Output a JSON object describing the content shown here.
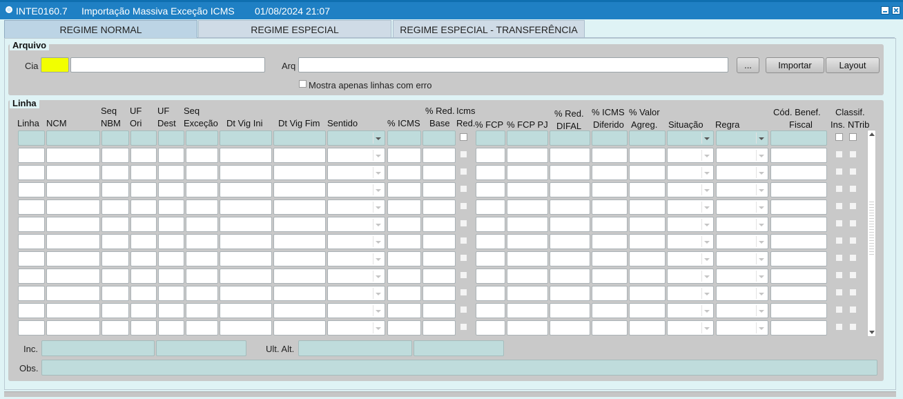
{
  "window": {
    "code": "INTE0160.7",
    "title": "Importação Massiva Exceção ICMS",
    "datetime": "01/08/2024 21:07"
  },
  "tabs": [
    {
      "label": "REGIME NORMAL",
      "active": true
    },
    {
      "label": "REGIME ESPECIAL",
      "active": false
    },
    {
      "label": "REGIME ESPECIAL - TRANSFERÊNCIA",
      "active": false
    }
  ],
  "arquivo": {
    "legend": "Arquivo",
    "cia_label": "Cia",
    "cia_value": "",
    "cia_name_value": "",
    "arq_label": "Arq",
    "arq_value": "",
    "browse_label": "...",
    "import_label": "Importar",
    "layout_label": "Layout",
    "only_errors_label": "Mostra apenas linhas com erro"
  },
  "linha": {
    "legend": "Linha",
    "headers": {
      "linha": "Linha",
      "ncm": "NCM",
      "seq_nbm_1": "Seq",
      "seq_nbm_2": "NBM",
      "uf_ori_1": "UF",
      "uf_ori_2": "Ori",
      "uf_dest_1": "UF",
      "uf_dest_2": "Dest",
      "seq_exc_1": "Seq",
      "seq_exc_2": "Exceção",
      "dt_vig_ini": "Dt Vig Ini",
      "dt_vig_fim": "Dt Vig Fim",
      "sentido": "Sentido",
      "pct_icms": "% ICMS",
      "pct_red_base_1": "% Red.",
      "pct_red_base_2": "Base",
      "icms_red_1": "Icms",
      "icms_red_2": "Red.",
      "pct_fcp": "% FCP",
      "pct_fcp_pj": "% FCP PJ",
      "pct_red_difal_1": "% Red.",
      "pct_red_difal_2": "DIFAL",
      "pct_icms_dif_1": "% ICMS",
      "pct_icms_dif_2": "Diferido",
      "pct_valor_agreg_1": "% Valor",
      "pct_valor_agreg_2": "Agreg.",
      "situacao": "Situação",
      "regra": "Regra",
      "cod_benef_1": "Cód. Benef.",
      "cod_benef_2": "Fiscal",
      "classif": "Classif.",
      "ins": "Ins.",
      "ntrib": "NTrib"
    },
    "row_count": 12,
    "inc_label": "Inc.",
    "ult_alt_label": "Ult. Alt.",
    "obs_label": "Obs."
  }
}
